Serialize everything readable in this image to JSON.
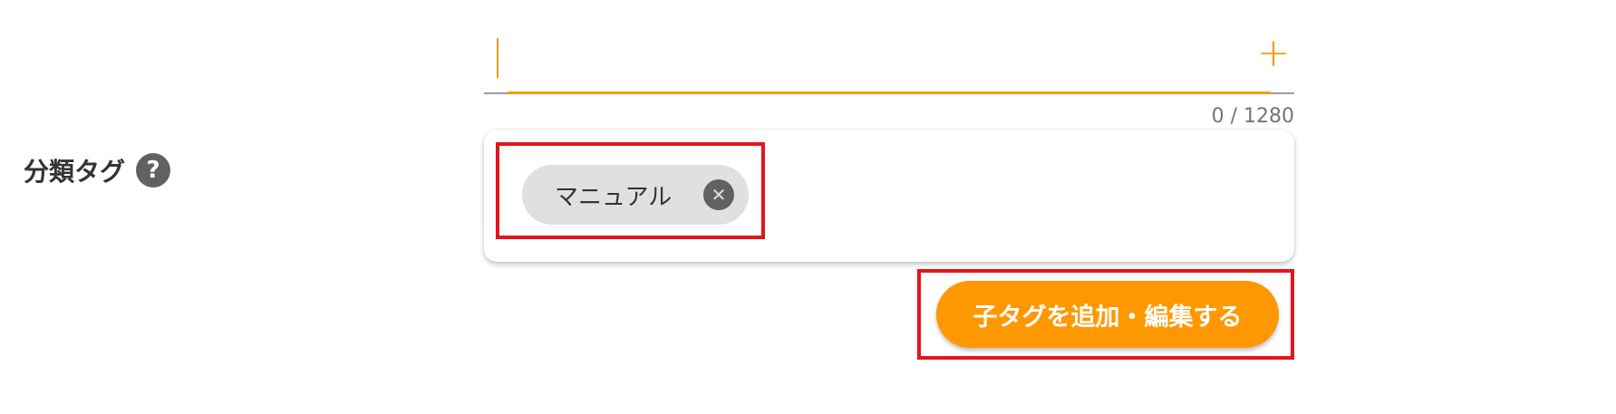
{
  "field": {
    "label": "分類タグ",
    "help_icon": "help-circle-icon",
    "help_glyph": "?"
  },
  "tag_input": {
    "value": "",
    "placeholder": "",
    "add_icon": "plus-icon",
    "add_glyph": "+",
    "counter": "0 / 1280"
  },
  "chips": [
    {
      "label": "マニュアル",
      "close_icon": "close-circle-icon",
      "close_glyph": "✕"
    }
  ],
  "actions": {
    "edit_child_tags_label": "子タグを追加・編集する"
  },
  "colors": {
    "accent": "#f39c12",
    "button": "#ff9800",
    "highlight": "#e5141c",
    "chip_bg": "#e0e0e0"
  }
}
